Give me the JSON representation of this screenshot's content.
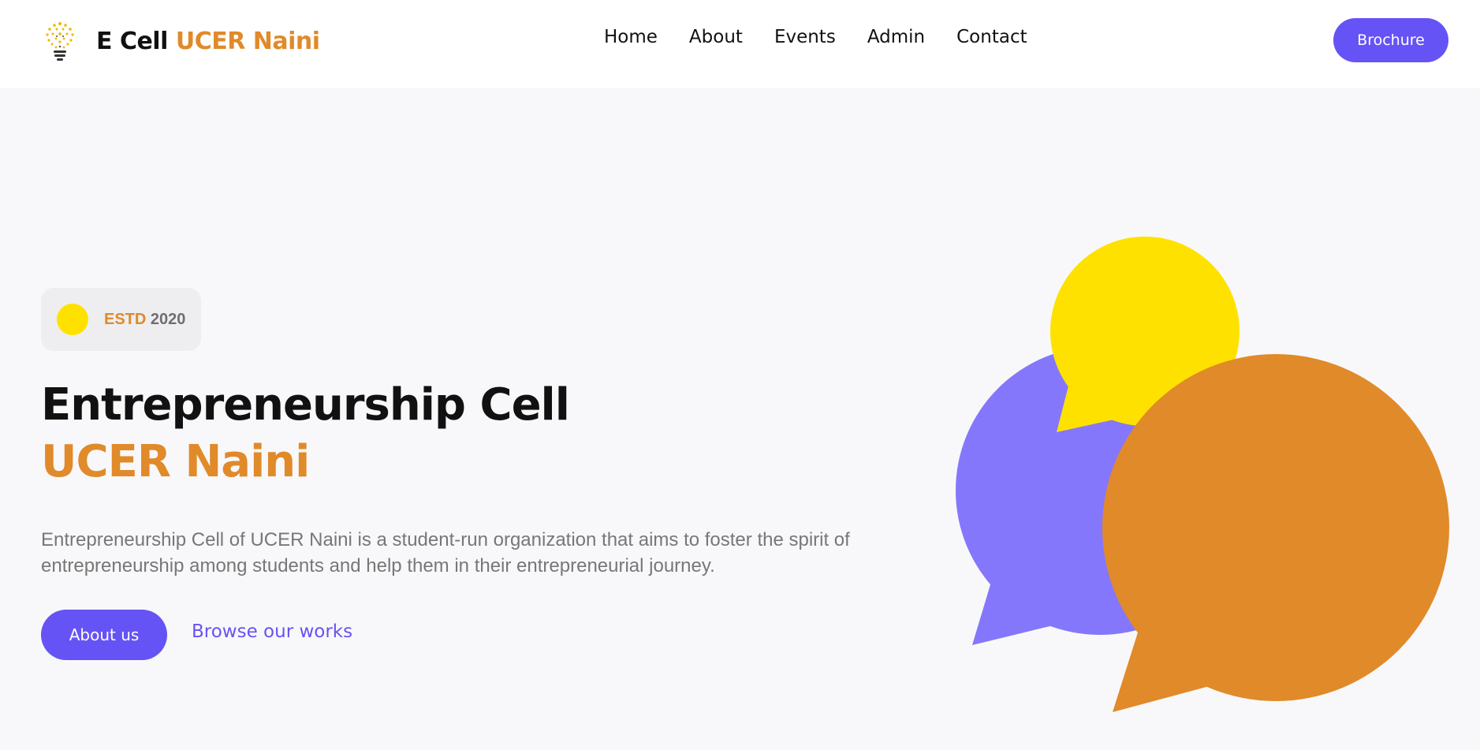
{
  "header": {
    "brand_part1": "E Cell",
    "brand_part2": "UCER Naini",
    "nav": [
      "Home",
      "About",
      "Events",
      "Admin",
      "Contact"
    ],
    "brochure_label": "Brochure"
  },
  "hero": {
    "badge_label": "ESTD",
    "badge_year": "2020",
    "title_line1": "Entrepreneurship Cell",
    "title_line2": "UCER Naini",
    "description": "Entrepreneurship Cell of UCER Naini is a student-run organization that aims to foster the spirit of entrepreneurship among students and help them in their entrepreneurial journey.",
    "about_label": "About us",
    "browse_label": "Browse our works"
  },
  "icons": {
    "logo": "lightbulb-icon",
    "badge_dot": "yellow-dot-icon",
    "illustration": "speech-bubbles-illustration"
  },
  "colors": {
    "accent_orange": "#e08a2a",
    "primary_purple": "#6653f5",
    "bubble_purple": "#8577fb",
    "bubble_yellow": "#ffe100",
    "bubble_orange": "#e08a2a",
    "background": "#f8f8fa"
  }
}
